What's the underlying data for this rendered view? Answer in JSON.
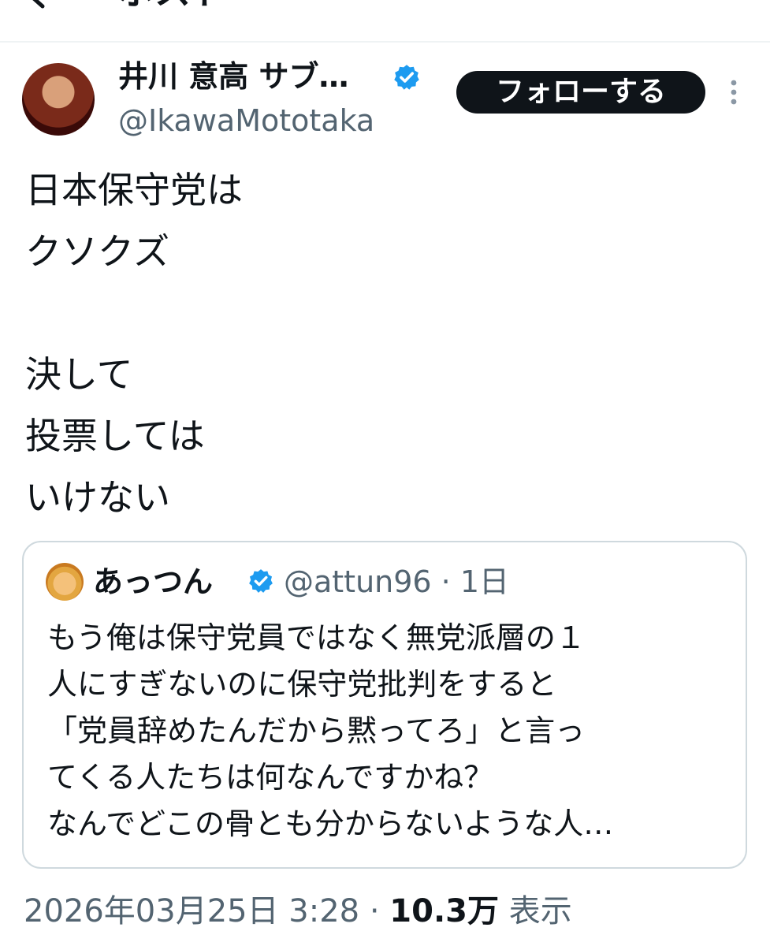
{
  "header": {
    "title": "ポスト"
  },
  "post": {
    "author_name": "井川 意高 サブ…",
    "author_handle": "@IkawaMototaka",
    "follow_label": "フォローする",
    "body_lines": [
      "日本保守党は",
      "クソクズ",
      "",
      "決して",
      "投票しては",
      "いけない"
    ],
    "timestamp": "2026年03月25日 3:28",
    "separator": " · ",
    "views_count": "10.3万",
    "views_label": " 表示"
  },
  "quote": {
    "author_name": "あっつん",
    "handle_time": "@attun96 · 1日",
    "lines": [
      "もう俺は保守党員ではなく無党派層の１",
      "人にすぎないのに保守党批判をすると",
      "「党員辞めたんだから黙ってろ」と言っ",
      "てくる人たちは何なんですかね？",
      "なんでどこの骨とも分からないような人…"
    ]
  },
  "colors": {
    "verified": "#1d9bf0",
    "text": "#0f1419",
    "secondary": "#536471",
    "border": "#cfd9de"
  },
  "icons": {
    "back": "back-arrow-icon",
    "verified": "verified-badge-icon",
    "more": "more-options-icon"
  }
}
